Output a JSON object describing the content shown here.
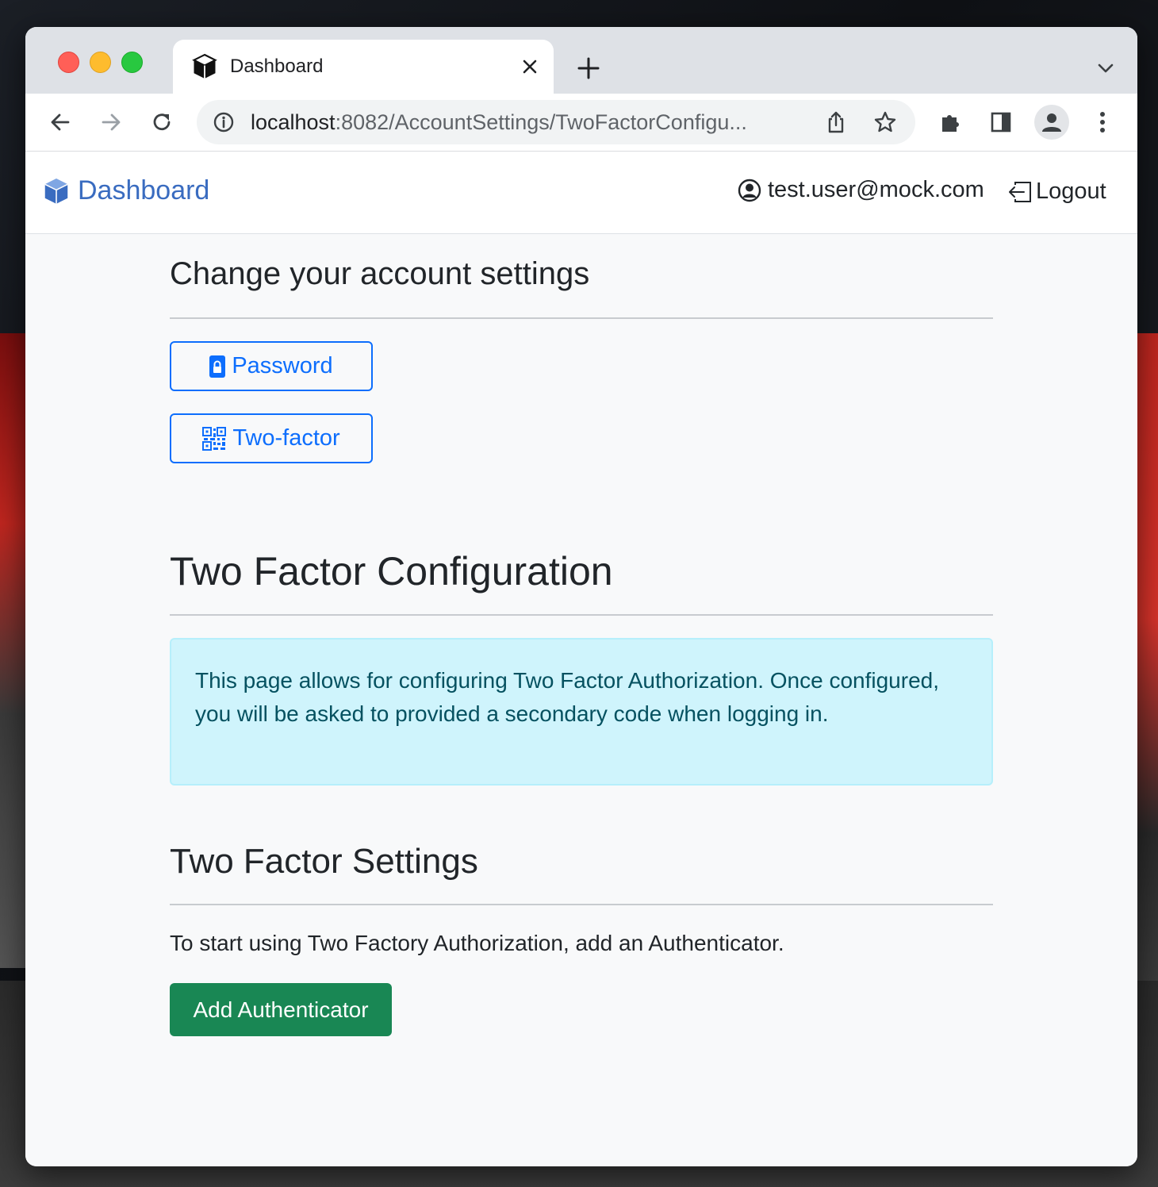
{
  "browser": {
    "tab": {
      "title": "Dashboard",
      "favicon": "box-icon"
    },
    "address_bar": {
      "host": "localhost",
      "rest": ":8082/AccountSettings/TwoFactorConfigu..."
    }
  },
  "navbar": {
    "brand": "Dashboard",
    "user_email": "test.user@mock.com",
    "logout": "Logout"
  },
  "account_settings": {
    "title": "Change your account settings",
    "buttons": {
      "password": "Password",
      "two_factor": "Two-factor"
    }
  },
  "two_factor_config": {
    "title": "Two Factor Configuration",
    "info": "This page allows for configuring Two Factor Authorization. Once configured, you will be asked to provided a secondary code when logging in."
  },
  "two_factor_settings": {
    "title": "Two Factor Settings",
    "instructions": "To start using Two Factory Authorization, add an Authenticator.",
    "add_button": "Add Authenticator"
  },
  "colors": {
    "primary": "#0d6efd",
    "brand": "#3a6cc0",
    "success": "#198754",
    "info_bg": "#cff4fc",
    "info_text": "#055160"
  }
}
